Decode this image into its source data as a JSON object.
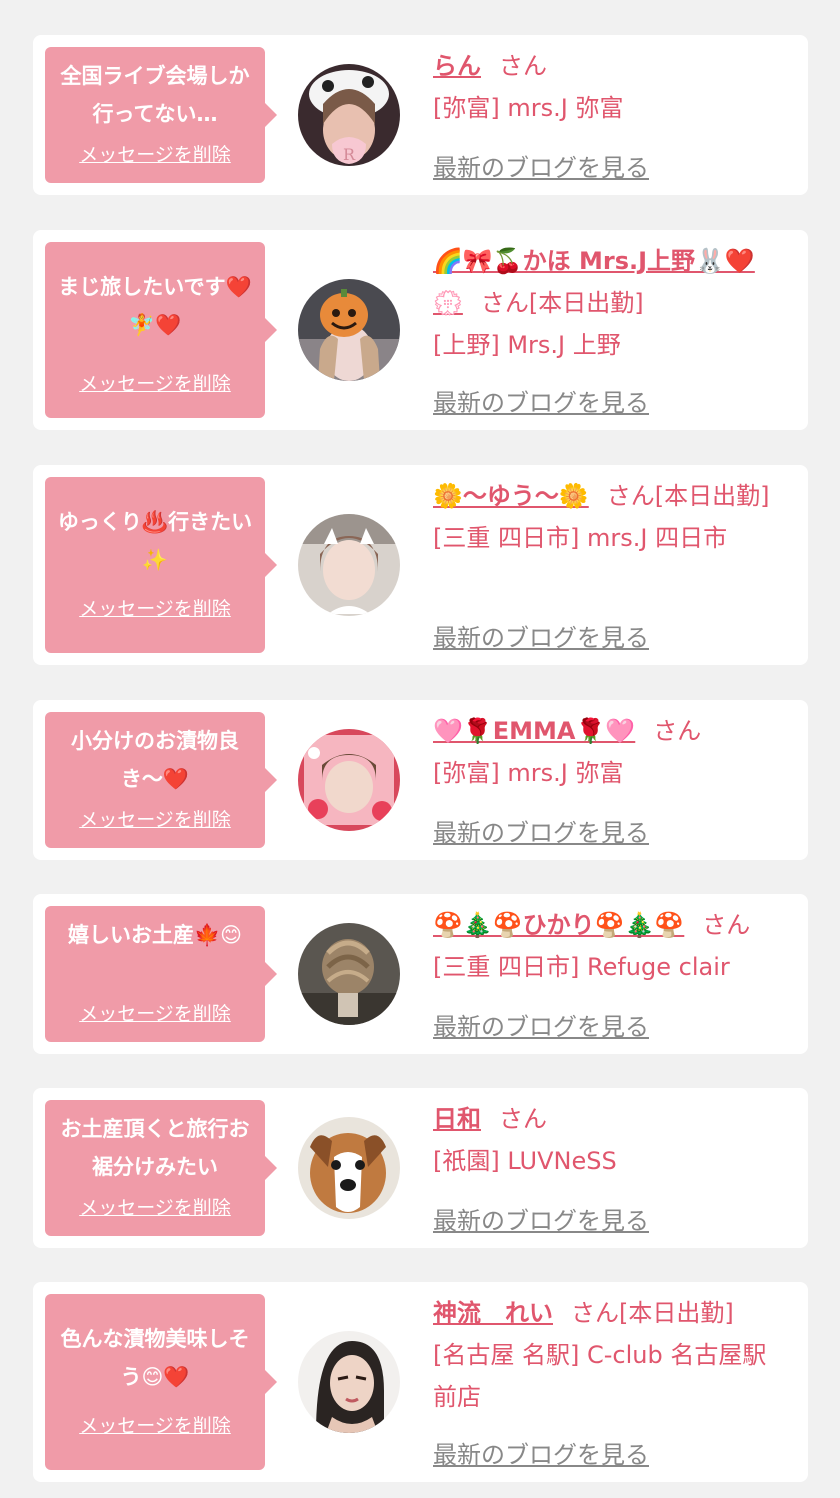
{
  "common": {
    "delete_label": "メッセージを削除",
    "blog_label": "最新のブログを見る"
  },
  "colors": {
    "background": "#f1f1f1",
    "bubble": "#f09ba8",
    "accent": "#e0566d",
    "link_gray": "#888888"
  },
  "messages": [
    {
      "message": "全国ライブ会場しか行ってない…",
      "name": "らん",
      "suffix": "さん",
      "shop": "[弥富] mrs.J 弥富",
      "avatar": "girl-with-white-hat-photo"
    },
    {
      "message": "まじ旅したいです❤️🧚❤️",
      "name": "🌈🎀🍒かほ Mrs.J上野🐰❤️💮",
      "suffix": "さん[本日出勤]",
      "shop": "[上野] Mrs.J 上野",
      "avatar": "girl-with-pumpkin-sticker-photo"
    },
    {
      "message": "ゆっくり♨️行きたい✨",
      "name": "🌼〜ゆう〜🌼",
      "suffix": "さん[本日出勤]",
      "shop": "[三重 四日市] mrs.J 四日市",
      "avatar": "girl-with-cat-ears-photo"
    },
    {
      "message": "小分けのお漬物良き〜❤️",
      "name": "🩷🌹EMMA🌹🩷",
      "suffix": "さん",
      "shop": "[弥富] mrs.J 弥富",
      "avatar": "girl-pink-frame-photo"
    },
    {
      "message": "嬉しいお土産🍁😊",
      "name": "🍄🎄🍄ひかり🍄🎄🍄",
      "suffix": "さん",
      "shop": "[三重 四日市] Refuge clair",
      "avatar": "hair-back-photo"
    },
    {
      "message": "お土産頂くと旅行お裾分けみたい",
      "name": "日和",
      "suffix": "さん",
      "shop": "[祇園] LUVNeSS",
      "avatar": "dog-photo"
    },
    {
      "message": "色んな漬物美味しそう😊❤️",
      "name": "神流　れい",
      "suffix": "さん[本日出勤]",
      "shop": "[名古屋 名駅] C-club 名古屋駅前店",
      "avatar": "woman-portrait-photo"
    }
  ]
}
